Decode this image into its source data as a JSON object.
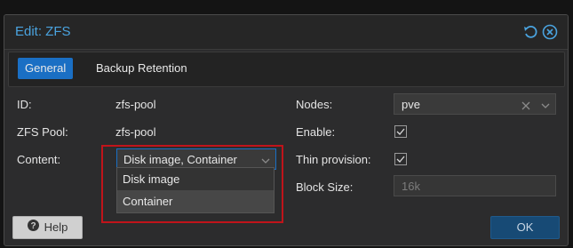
{
  "dialog": {
    "title": "Edit: ZFS",
    "icons": {
      "reset": "reset-icon",
      "close": "close-icon"
    }
  },
  "tabs": [
    {
      "label": "General",
      "active": true
    },
    {
      "label": "Backup Retention",
      "active": false
    }
  ],
  "form": {
    "id_label": "ID:",
    "id_value": "zfs-pool",
    "pool_label": "ZFS Pool:",
    "pool_value": "zfs-pool",
    "content_label": "Content:",
    "content_value": "Disk image, Container",
    "nodes_label": "Nodes:",
    "nodes_value": "pve",
    "enable_label": "Enable:",
    "enable_checked": true,
    "thin_label": "Thin provision:",
    "thin_checked": true,
    "blocksize_label": "Block Size:",
    "blocksize_placeholder": "16k"
  },
  "content_dropdown": {
    "options": [
      "Disk image",
      "Container"
    ]
  },
  "footer": {
    "help_label": "Help",
    "ok_label": "OK"
  },
  "colors": {
    "accent": "#1a6fc4",
    "title": "#4aa3df",
    "highlight": "#c0141a"
  }
}
